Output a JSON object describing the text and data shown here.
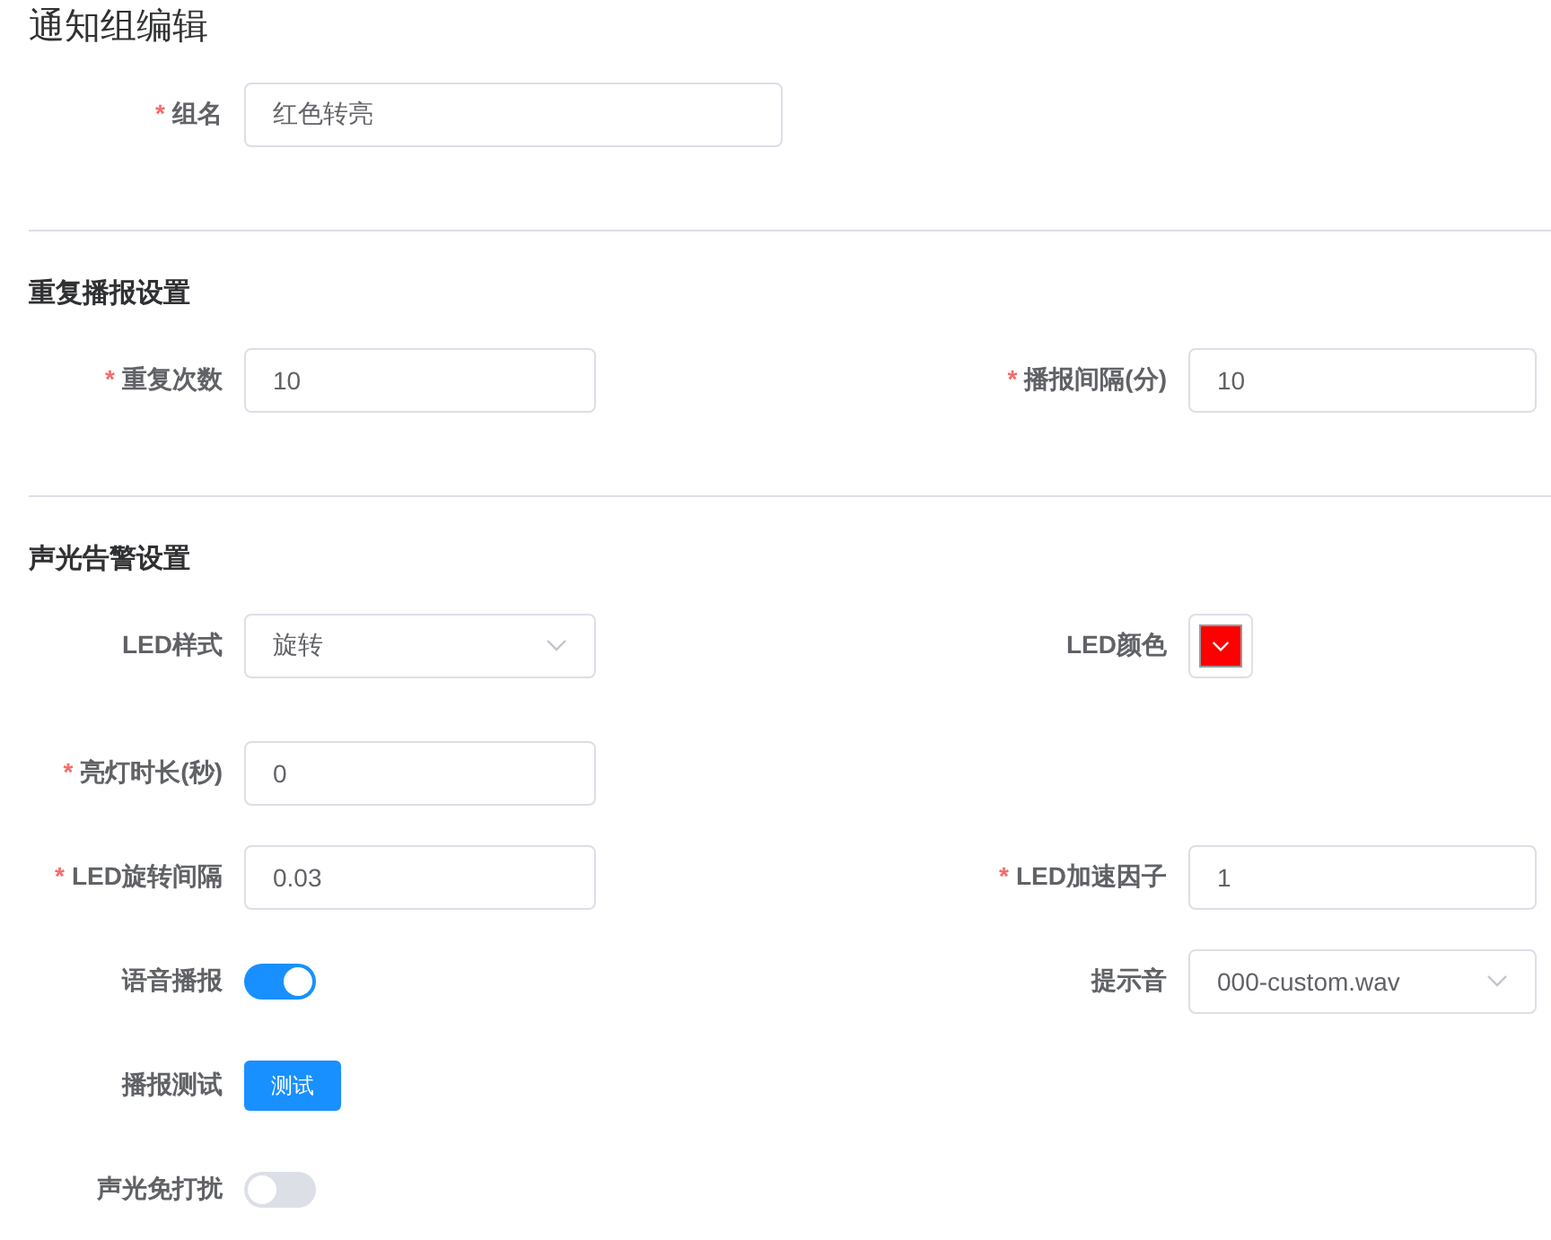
{
  "title": "通知组编辑",
  "sections": [
    {
      "rows": [
        {
          "fields": [
            {
              "kind": "input",
              "label": "组名",
              "mark": "*",
              "value": "红色转亮"
            }
          ]
        }
      ]
    },
    {
      "title": "重复播报设置",
      "rows": [
        {
          "fields": [
            {
              "kind": "input",
              "label": "重复次数",
              "mark": "*",
              "value": "10"
            },
            {
              "kind": "input",
              "label": "播报间隔(分)",
              "mark": "*",
              "value": "10"
            }
          ]
        }
      ]
    },
    {
      "title": "声光告警设置",
      "rows": [
        {
          "fields": [
            {
              "kind": "select",
              "label": "LED样式",
              "value": "旋转"
            },
            {
              "kind": "color",
              "label": "LED颜色",
              "color": "#ff0000"
            }
          ]
        },
        {
          "fields": [
            {
              "kind": "input",
              "label": "亮灯时长(秒)",
              "mark": "*",
              "value": "0"
            }
          ]
        },
        {
          "fields": [
            {
              "kind": "input",
              "label": "LED旋转间隔",
              "mark": "*",
              "value": "0.03"
            },
            {
              "kind": "input",
              "label": "LED加速因子",
              "mark": "*",
              "value": "1"
            }
          ]
        },
        {
          "fields": [
            {
              "kind": "switch",
              "label": "语音播报",
              "on": true
            },
            {
              "kind": "select",
              "label": "提示音",
              "value": "000-custom.wav"
            }
          ]
        },
        {
          "fields": [
            {
              "kind": "button",
              "label": "播报测试",
              "button": "测试"
            }
          ]
        },
        {
          "fields": [
            {
              "kind": "switch",
              "label": "声光免打扰",
              "on": false
            }
          ]
        }
      ]
    }
  ]
}
